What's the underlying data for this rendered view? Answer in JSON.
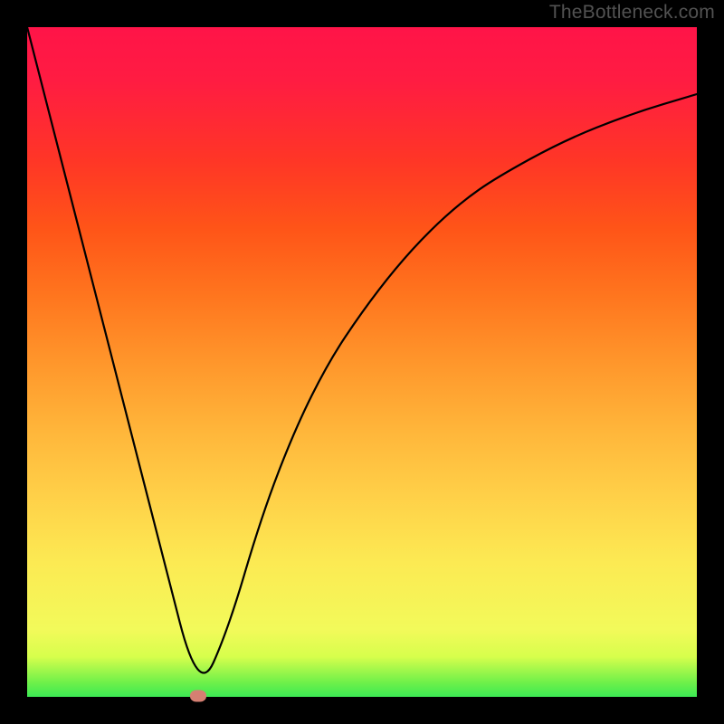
{
  "watermark": "TheBottleneck.com",
  "chart_data": {
    "type": "line",
    "title": "",
    "xlabel": "",
    "ylabel": "",
    "xlim": [
      0,
      1
    ],
    "ylim": [
      0,
      1
    ],
    "x": [
      0.0,
      0.05,
      0.1,
      0.15,
      0.2,
      0.256,
      0.3,
      0.35,
      0.4,
      0.45,
      0.5,
      0.55,
      0.6,
      0.65,
      0.7,
      0.8,
      0.9,
      1.0
    ],
    "y": [
      1.0,
      0.805,
      0.61,
      0.415,
      0.22,
      0.002,
      0.1,
      0.27,
      0.4,
      0.5,
      0.575,
      0.64,
      0.695,
      0.74,
      0.775,
      0.83,
      0.87,
      0.9
    ],
    "marker": {
      "x": 0.256,
      "y": 0.002
    },
    "background_gradient": {
      "orientation": "vertical",
      "top_color": "#ff1448",
      "bottom_color": "#3cea54"
    }
  },
  "colors": {
    "frame": "#000000",
    "curve": "#000000",
    "marker": "#d57f72",
    "watermark": "#525252"
  }
}
